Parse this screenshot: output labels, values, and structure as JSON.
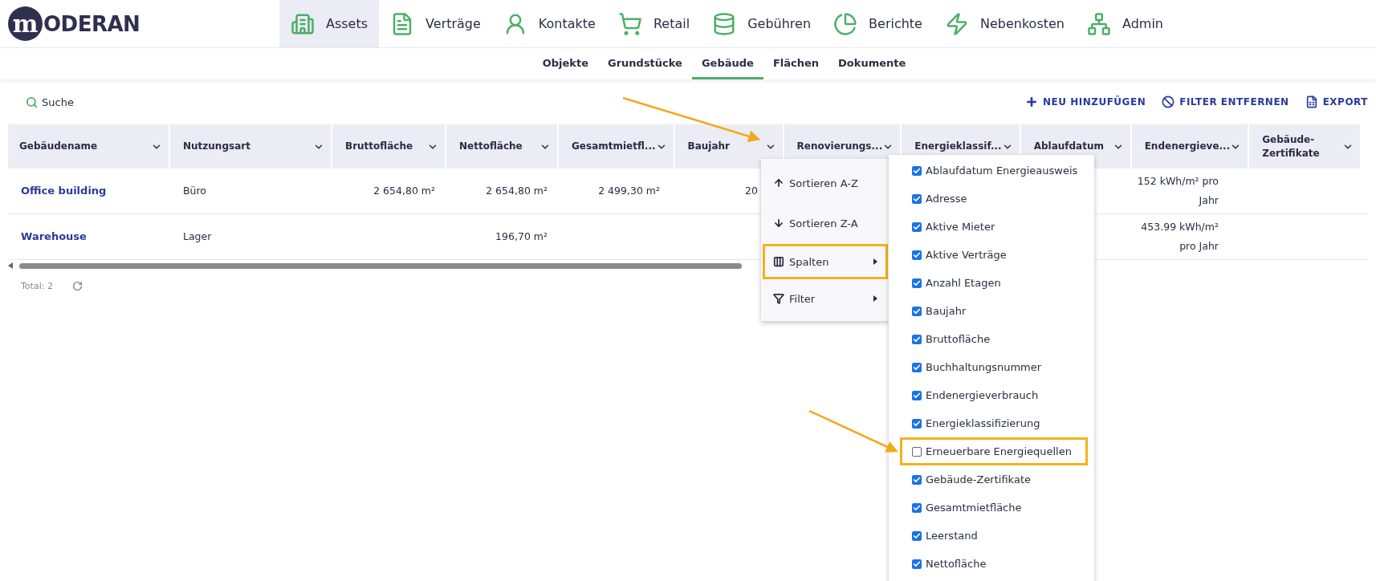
{
  "logo": {
    "mark": "m",
    "text": "ODERAN"
  },
  "nav": [
    {
      "label": "Assets",
      "selected": true
    },
    {
      "label": "Verträge",
      "selected": false
    },
    {
      "label": "Kontakte",
      "selected": false
    },
    {
      "label": "Retail",
      "selected": false
    },
    {
      "label": "Gebühren",
      "selected": false
    },
    {
      "label": "Berichte",
      "selected": false
    },
    {
      "label": "Nebenkosten",
      "selected": false
    },
    {
      "label": "Admin",
      "selected": false
    }
  ],
  "subnav": [
    {
      "label": "Objekte",
      "selected": false
    },
    {
      "label": "Grundstücke",
      "selected": false
    },
    {
      "label": "Gebäude",
      "selected": true
    },
    {
      "label": "Flächen",
      "selected": false
    },
    {
      "label": "Dokumente",
      "selected": false
    }
  ],
  "toolbar": {
    "search": "Suche",
    "actions": [
      "NEU HINZUFÜGEN",
      "FILTER ENTFERNEN",
      "EXPORT"
    ]
  },
  "table": {
    "columns": [
      "Gebäudename",
      "Nutzungsart",
      "Bruttofläche",
      "Nettofläche",
      "Gesamtmietfl...",
      "Baujahr",
      "Renovierungs...",
      "Energieklassif...",
      "Ablaufdatum",
      "Endenergieve...",
      "Gebäude-Zertifikate"
    ],
    "rows": [
      [
        "Office building",
        "Büro",
        "2 654,80 m²",
        "2 654,80 m²",
        "2 499,30 m²",
        "20",
        "",
        "",
        "",
        "152 kWh/m² pro Jahr",
        ""
      ],
      [
        "Warehouse",
        "Lager",
        "",
        "196,70 m²",
        "",
        "",
        "",
        "",
        "",
        "453.99 kWh/m² pro Jahr",
        ""
      ]
    ]
  },
  "footer": {
    "total": "Total: 2"
  },
  "column_menu": [
    {
      "label": "Sortieren A-Z",
      "highlighted": false,
      "submenu": false
    },
    {
      "label": "Sortieren Z-A",
      "highlighted": false,
      "submenu": false
    },
    {
      "label": "Spalten",
      "highlighted": true,
      "submenu": true
    },
    {
      "label": "Filter",
      "highlighted": false,
      "submenu": true
    }
  ],
  "columns_submenu": [
    {
      "label": "Ablaufdatum Energieausweis",
      "checked": true,
      "highlighted": false
    },
    {
      "label": "Adresse",
      "checked": true,
      "highlighted": false
    },
    {
      "label": "Aktive Mieter",
      "checked": true,
      "highlighted": false
    },
    {
      "label": "Aktive Verträge",
      "checked": true,
      "highlighted": false
    },
    {
      "label": "Anzahl Etagen",
      "checked": true,
      "highlighted": false
    },
    {
      "label": "Baujahr",
      "checked": true,
      "highlighted": false
    },
    {
      "label": "Bruttofläche",
      "checked": true,
      "highlighted": false
    },
    {
      "label": "Buchhaltungsnummer",
      "checked": true,
      "highlighted": false
    },
    {
      "label": "Endenergieverbrauch",
      "checked": true,
      "highlighted": false
    },
    {
      "label": "Energieklassifizierung",
      "checked": true,
      "highlighted": false
    },
    {
      "label": "Erneuerbare Energiequellen",
      "checked": false,
      "highlighted": true
    },
    {
      "label": "Gebäude-Zertifikate",
      "checked": true,
      "highlighted": false
    },
    {
      "label": "Gesamtmietfläche",
      "checked": true,
      "highlighted": false
    },
    {
      "label": "Leerstand",
      "checked": true,
      "highlighted": false
    },
    {
      "label": "Nettofläche",
      "checked": true,
      "highlighted": false
    }
  ]
}
